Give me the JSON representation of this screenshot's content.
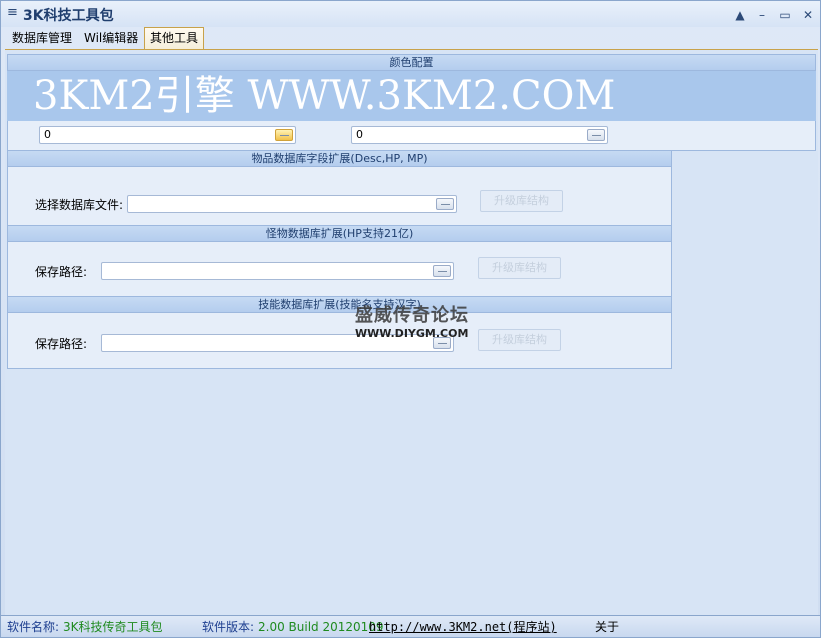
{
  "window": {
    "title": "3K科技工具包",
    "menu_icon": "menu-icon",
    "controls": {
      "up": "▲",
      "minimize": "–",
      "maximize": "▭",
      "close": "✕"
    }
  },
  "tabs": [
    {
      "label": "数据库管理"
    },
    {
      "label": "Wil编辑器"
    },
    {
      "label": "其他工具",
      "active": true
    }
  ],
  "color_config": {
    "header": "颜色配置",
    "banner_text": "3KM2引擎 WWW.3KM2.COM",
    "left_value": "0",
    "right_value": "0"
  },
  "item_ext": {
    "header": "物品数据库字段扩展(Desc,HP, MP)",
    "label": "选择数据库文件:",
    "value": "",
    "button": "升级库结构"
  },
  "monster_ext": {
    "header": "怪物数据库扩展(HP支持21亿)",
    "label": "保存路径:",
    "value": "",
    "button": "升级库结构"
  },
  "skill_ext": {
    "header": "技能数据库扩展(技能名支持汉字)",
    "label": "保存路径:",
    "value": "",
    "button": "升级库结构"
  },
  "watermark": {
    "cn": "盛威传奇论坛",
    "url": "WWW.DIYGM.COM"
  },
  "status": {
    "name_label": "软件名称:",
    "name_value": "3K科技传奇工具包",
    "version_label": "软件版本:",
    "version_value": "2.00 Build 20120109",
    "link": "http://www.3KM2.net(程序站)",
    "about": "关于"
  },
  "colors": {
    "accent": "#1f3e6e",
    "banner": "#a9c7ec",
    "status_green": "#1f8a1f"
  }
}
